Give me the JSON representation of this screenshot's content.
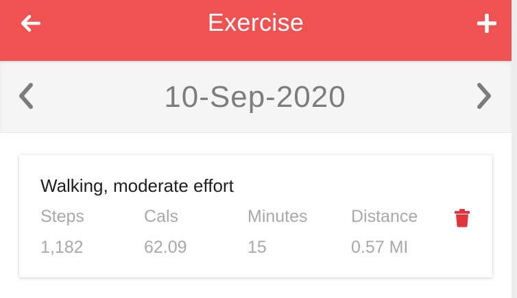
{
  "header": {
    "title": "Exercise",
    "back_icon": "arrow-left-icon",
    "add_icon": "plus-icon",
    "background_color": "#f05151"
  },
  "datebar": {
    "date": "10-Sep-2020",
    "prev_icon": "chevron-left-icon",
    "next_icon": "chevron-right-icon"
  },
  "entries": [
    {
      "name": "Walking, moderate effort",
      "stats": [
        {
          "label": "Steps",
          "value": "1,182"
        },
        {
          "label": "Cals",
          "value": "62.09"
        },
        {
          "label": "Minutes",
          "value": "15"
        },
        {
          "label": "Distance",
          "value": "0.57 MI"
        }
      ],
      "delete_icon": "trash-icon",
      "delete_color": "#e0363b"
    }
  ]
}
